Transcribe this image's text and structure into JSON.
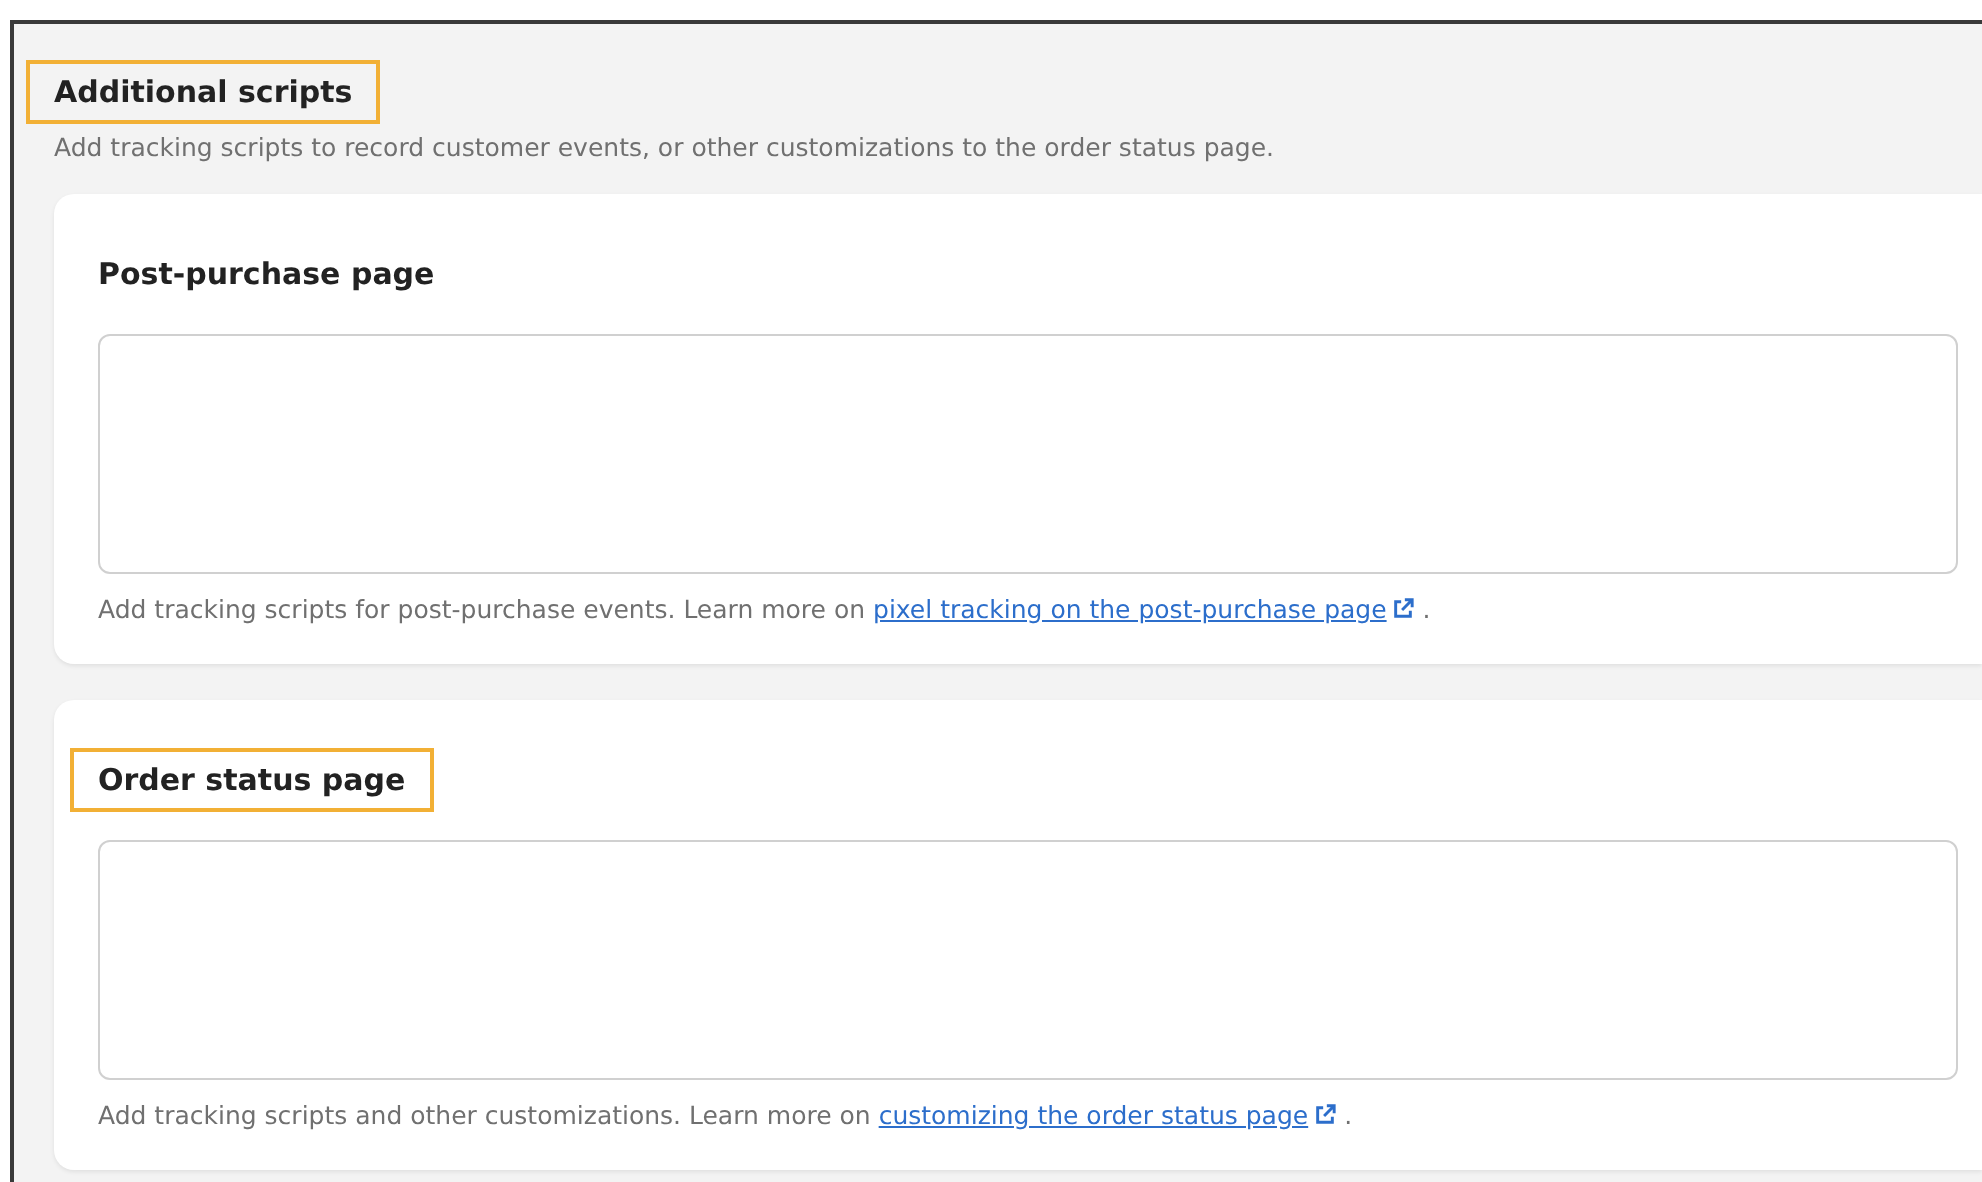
{
  "section": {
    "title": "Additional scripts",
    "highlighted": true,
    "description": "Add tracking scripts to record customer events, or other customizations to the order status page."
  },
  "cards": [
    {
      "title": "Post-purchase page",
      "highlighted": false,
      "help": "Add tracking scripts for post-purchase events. Learn more on",
      "link": "pixel tracking on the post-purchase page",
      "after": "."
    },
    {
      "title": "Order status page",
      "highlighted": true,
      "help": "Add tracking scripts and other customizations. Learn more on",
      "link": "customizing the order status page",
      "after": "."
    }
  ]
}
